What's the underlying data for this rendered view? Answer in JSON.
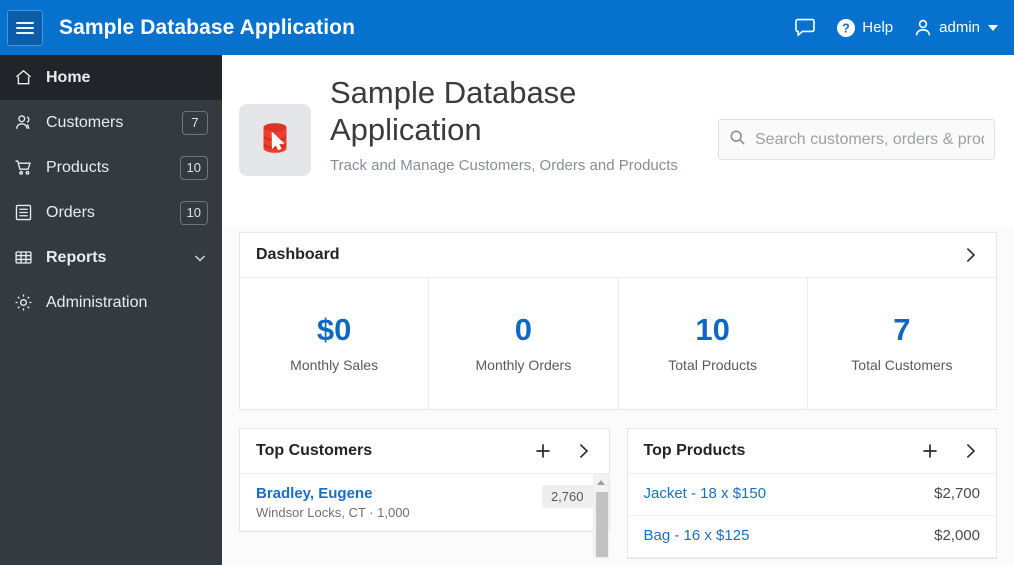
{
  "header": {
    "menu_icon": "hamburger-icon",
    "title": "Sample Database Application",
    "chat_icon": "chat-bubble-icon",
    "help_label": "Help",
    "help_icon": "question-circle-icon",
    "user_label": "admin",
    "user_icon": "person-icon",
    "caret_icon": "caret-down-icon",
    "accent_color": "#0672ce"
  },
  "sidebar": {
    "background_color": "#343a40",
    "active_background_color": "#212529",
    "items": [
      {
        "label": "Home",
        "icon": "home-icon",
        "badge": "",
        "active": true,
        "chevron": false
      },
      {
        "label": "Customers",
        "icon": "people-icon",
        "badge": "7",
        "active": false,
        "chevron": false
      },
      {
        "label": "Products",
        "icon": "cart-icon",
        "badge": "10",
        "active": false,
        "chevron": false
      },
      {
        "label": "Orders",
        "icon": "list-icon",
        "badge": "10",
        "active": false,
        "chevron": false
      },
      {
        "label": "Reports",
        "icon": "table-icon",
        "badge": "",
        "active": false,
        "chevron": true
      },
      {
        "label": "Administration",
        "icon": "gear-icon",
        "badge": "",
        "active": false,
        "chevron": false
      }
    ]
  },
  "hero": {
    "logo_icon": "database-cursor-icon",
    "title": "Sample Database Application",
    "subtitle": "Track and Manage Customers, Orders and Products"
  },
  "search": {
    "icon": "search-icon",
    "value": "",
    "placeholder": "Search customers, orders & products"
  },
  "dashboard": {
    "title": "Dashboard",
    "more_icon": "chevron-right-icon",
    "kpis": [
      {
        "value": "$0",
        "label": "Monthly Sales"
      },
      {
        "value": "0",
        "label": "Monthly Orders"
      },
      {
        "value": "10",
        "label": "Total Products"
      },
      {
        "value": "7",
        "label": "Total Customers"
      }
    ],
    "kpi_value_color": "#0e68c4"
  },
  "top_customers": {
    "title": "Top Customers",
    "add_icon": "plus-icon",
    "more_icon": "chevron-right-icon",
    "scrollbar_up_icon": "triangle-up-icon",
    "rows": [
      {
        "name": "Bradley, Eugene",
        "detail": "Windsor Locks, CT · 1,000",
        "value": "2,760"
      }
    ]
  },
  "top_products": {
    "title": "Top Products",
    "add_icon": "plus-icon",
    "more_icon": "chevron-right-icon",
    "rows": [
      {
        "name": "Jacket - 18 x $150",
        "amount": "$2,700"
      },
      {
        "name": "Bag - 16 x $125",
        "amount": "$2,000"
      }
    ]
  }
}
